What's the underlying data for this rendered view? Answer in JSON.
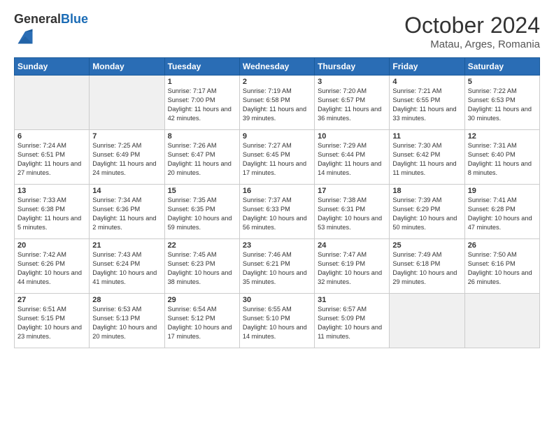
{
  "header": {
    "logo_general": "General",
    "logo_blue": "Blue",
    "month": "October 2024",
    "location": "Matau, Arges, Romania"
  },
  "days_of_week": [
    "Sunday",
    "Monday",
    "Tuesday",
    "Wednesday",
    "Thursday",
    "Friday",
    "Saturday"
  ],
  "weeks": [
    [
      {
        "num": "",
        "sunrise": "",
        "sunset": "",
        "daylight": "",
        "empty": true
      },
      {
        "num": "",
        "sunrise": "",
        "sunset": "",
        "daylight": "",
        "empty": true
      },
      {
        "num": "1",
        "sunrise": "Sunrise: 7:17 AM",
        "sunset": "Sunset: 7:00 PM",
        "daylight": "Daylight: 11 hours and 42 minutes."
      },
      {
        "num": "2",
        "sunrise": "Sunrise: 7:19 AM",
        "sunset": "Sunset: 6:58 PM",
        "daylight": "Daylight: 11 hours and 39 minutes."
      },
      {
        "num": "3",
        "sunrise": "Sunrise: 7:20 AM",
        "sunset": "Sunset: 6:57 PM",
        "daylight": "Daylight: 11 hours and 36 minutes."
      },
      {
        "num": "4",
        "sunrise": "Sunrise: 7:21 AM",
        "sunset": "Sunset: 6:55 PM",
        "daylight": "Daylight: 11 hours and 33 minutes."
      },
      {
        "num": "5",
        "sunrise": "Sunrise: 7:22 AM",
        "sunset": "Sunset: 6:53 PM",
        "daylight": "Daylight: 11 hours and 30 minutes."
      }
    ],
    [
      {
        "num": "6",
        "sunrise": "Sunrise: 7:24 AM",
        "sunset": "Sunset: 6:51 PM",
        "daylight": "Daylight: 11 hours and 27 minutes."
      },
      {
        "num": "7",
        "sunrise": "Sunrise: 7:25 AM",
        "sunset": "Sunset: 6:49 PM",
        "daylight": "Daylight: 11 hours and 24 minutes."
      },
      {
        "num": "8",
        "sunrise": "Sunrise: 7:26 AM",
        "sunset": "Sunset: 6:47 PM",
        "daylight": "Daylight: 11 hours and 20 minutes."
      },
      {
        "num": "9",
        "sunrise": "Sunrise: 7:27 AM",
        "sunset": "Sunset: 6:45 PM",
        "daylight": "Daylight: 11 hours and 17 minutes."
      },
      {
        "num": "10",
        "sunrise": "Sunrise: 7:29 AM",
        "sunset": "Sunset: 6:44 PM",
        "daylight": "Daylight: 11 hours and 14 minutes."
      },
      {
        "num": "11",
        "sunrise": "Sunrise: 7:30 AM",
        "sunset": "Sunset: 6:42 PM",
        "daylight": "Daylight: 11 hours and 11 minutes."
      },
      {
        "num": "12",
        "sunrise": "Sunrise: 7:31 AM",
        "sunset": "Sunset: 6:40 PM",
        "daylight": "Daylight: 11 hours and 8 minutes."
      }
    ],
    [
      {
        "num": "13",
        "sunrise": "Sunrise: 7:33 AM",
        "sunset": "Sunset: 6:38 PM",
        "daylight": "Daylight: 11 hours and 5 minutes."
      },
      {
        "num": "14",
        "sunrise": "Sunrise: 7:34 AM",
        "sunset": "Sunset: 6:36 PM",
        "daylight": "Daylight: 11 hours and 2 minutes."
      },
      {
        "num": "15",
        "sunrise": "Sunrise: 7:35 AM",
        "sunset": "Sunset: 6:35 PM",
        "daylight": "Daylight: 10 hours and 59 minutes."
      },
      {
        "num": "16",
        "sunrise": "Sunrise: 7:37 AM",
        "sunset": "Sunset: 6:33 PM",
        "daylight": "Daylight: 10 hours and 56 minutes."
      },
      {
        "num": "17",
        "sunrise": "Sunrise: 7:38 AM",
        "sunset": "Sunset: 6:31 PM",
        "daylight": "Daylight: 10 hours and 53 minutes."
      },
      {
        "num": "18",
        "sunrise": "Sunrise: 7:39 AM",
        "sunset": "Sunset: 6:29 PM",
        "daylight": "Daylight: 10 hours and 50 minutes."
      },
      {
        "num": "19",
        "sunrise": "Sunrise: 7:41 AM",
        "sunset": "Sunset: 6:28 PM",
        "daylight": "Daylight: 10 hours and 47 minutes."
      }
    ],
    [
      {
        "num": "20",
        "sunrise": "Sunrise: 7:42 AM",
        "sunset": "Sunset: 6:26 PM",
        "daylight": "Daylight: 10 hours and 44 minutes."
      },
      {
        "num": "21",
        "sunrise": "Sunrise: 7:43 AM",
        "sunset": "Sunset: 6:24 PM",
        "daylight": "Daylight: 10 hours and 41 minutes."
      },
      {
        "num": "22",
        "sunrise": "Sunrise: 7:45 AM",
        "sunset": "Sunset: 6:23 PM",
        "daylight": "Daylight: 10 hours and 38 minutes."
      },
      {
        "num": "23",
        "sunrise": "Sunrise: 7:46 AM",
        "sunset": "Sunset: 6:21 PM",
        "daylight": "Daylight: 10 hours and 35 minutes."
      },
      {
        "num": "24",
        "sunrise": "Sunrise: 7:47 AM",
        "sunset": "Sunset: 6:19 PM",
        "daylight": "Daylight: 10 hours and 32 minutes."
      },
      {
        "num": "25",
        "sunrise": "Sunrise: 7:49 AM",
        "sunset": "Sunset: 6:18 PM",
        "daylight": "Daylight: 10 hours and 29 minutes."
      },
      {
        "num": "26",
        "sunrise": "Sunrise: 7:50 AM",
        "sunset": "Sunset: 6:16 PM",
        "daylight": "Daylight: 10 hours and 26 minutes."
      }
    ],
    [
      {
        "num": "27",
        "sunrise": "Sunrise: 6:51 AM",
        "sunset": "Sunset: 5:15 PM",
        "daylight": "Daylight: 10 hours and 23 minutes."
      },
      {
        "num": "28",
        "sunrise": "Sunrise: 6:53 AM",
        "sunset": "Sunset: 5:13 PM",
        "daylight": "Daylight: 10 hours and 20 minutes."
      },
      {
        "num": "29",
        "sunrise": "Sunrise: 6:54 AM",
        "sunset": "Sunset: 5:12 PM",
        "daylight": "Daylight: 10 hours and 17 minutes."
      },
      {
        "num": "30",
        "sunrise": "Sunrise: 6:55 AM",
        "sunset": "Sunset: 5:10 PM",
        "daylight": "Daylight: 10 hours and 14 minutes."
      },
      {
        "num": "31",
        "sunrise": "Sunrise: 6:57 AM",
        "sunset": "Sunset: 5:09 PM",
        "daylight": "Daylight: 10 hours and 11 minutes."
      },
      {
        "num": "",
        "sunrise": "",
        "sunset": "",
        "daylight": "",
        "empty": true
      },
      {
        "num": "",
        "sunrise": "",
        "sunset": "",
        "daylight": "",
        "empty": true
      }
    ]
  ]
}
